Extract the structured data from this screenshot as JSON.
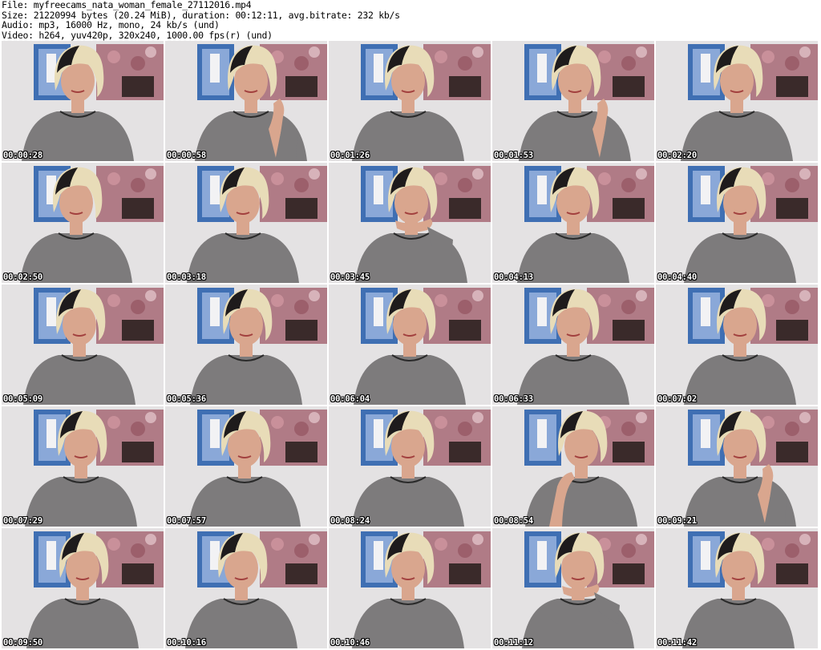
{
  "header": {
    "file_line": "File: myfreecams_nata_woman_female_27112016.mp4",
    "size_line": "Size: 21220994 bytes (20.24 MiB), duration: 00:12:11, avg.bitrate: 232 kb/s",
    "audio_line": "Audio: mp3, 16000 Hz, mono, 24 kb/s (und)",
    "video_line": "Video: h264, yuv420p, 320x240, 1000.00 fps(r) (und)"
  },
  "thumbnails": [
    {
      "timestamp": "00:00:28"
    },
    {
      "timestamp": "00:00:58"
    },
    {
      "timestamp": "00:01:26"
    },
    {
      "timestamp": "00:01:53"
    },
    {
      "timestamp": "00:02:20"
    },
    {
      "timestamp": "00:02:50"
    },
    {
      "timestamp": "00:03:18"
    },
    {
      "timestamp": "00:03:45"
    },
    {
      "timestamp": "00:04:13"
    },
    {
      "timestamp": "00:04:40"
    },
    {
      "timestamp": "00:05:09"
    },
    {
      "timestamp": "00:05:36"
    },
    {
      "timestamp": "00:06:04"
    },
    {
      "timestamp": "00:06:33"
    },
    {
      "timestamp": "00:07:02"
    },
    {
      "timestamp": "00:07:29"
    },
    {
      "timestamp": "00:07:57"
    },
    {
      "timestamp": "00:08:24"
    },
    {
      "timestamp": "00:08:54"
    },
    {
      "timestamp": "00:09:21"
    },
    {
      "timestamp": "00:09:50"
    },
    {
      "timestamp": "00:10:16"
    },
    {
      "timestamp": "00:10:46"
    },
    {
      "timestamp": "00:11:12"
    },
    {
      "timestamp": "00:11:42"
    }
  ],
  "colors": {
    "wall": "#e4e2e3",
    "poster_blue": "#3f6fb3",
    "poster_floral": "#b07b86",
    "sweater": "#7d7b7c",
    "hair_blonde": "#e8dcb8",
    "hair_dark": "#1e1b1c",
    "skin": "#d9a68e",
    "timestamp_text": "#ffffff"
  }
}
